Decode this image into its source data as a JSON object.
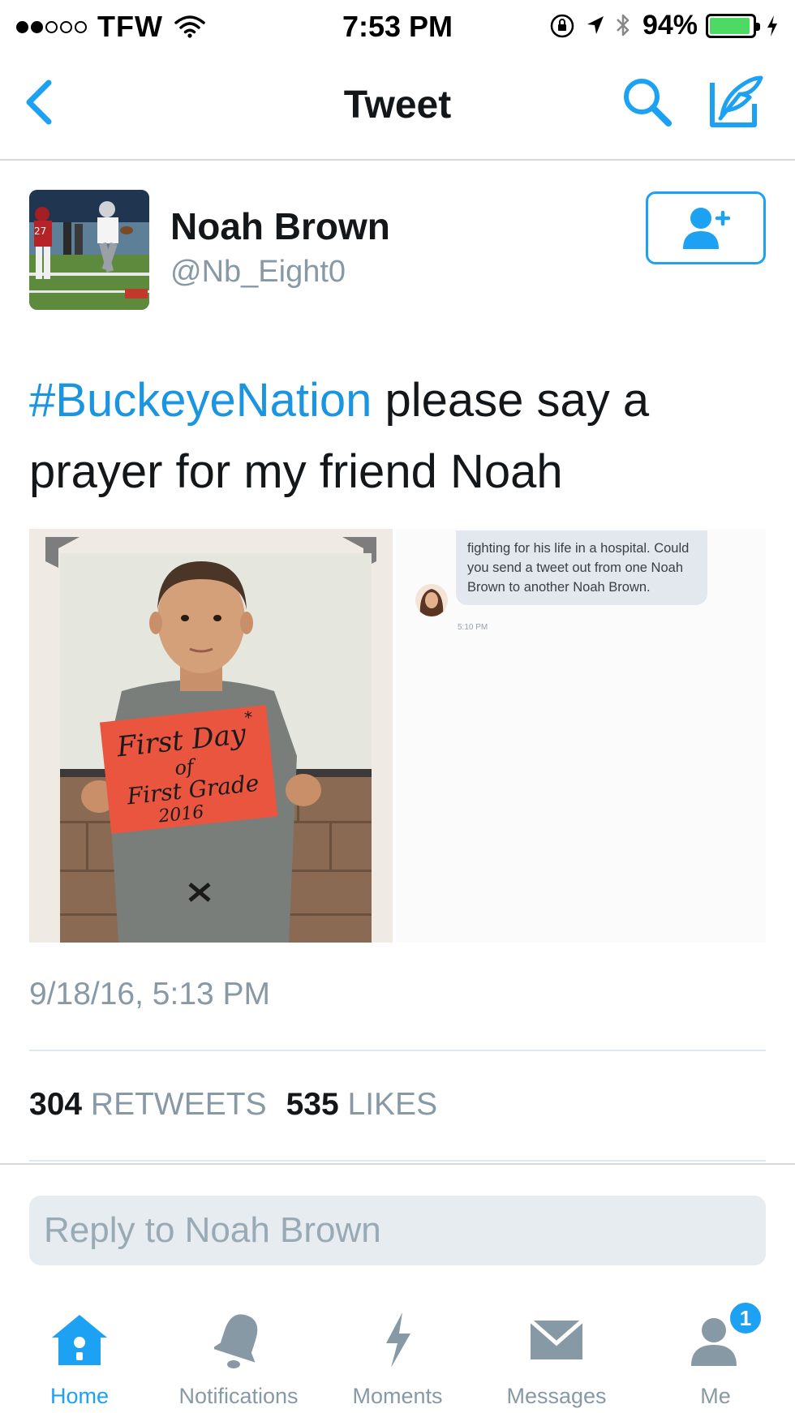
{
  "status_bar": {
    "carrier": "TFW",
    "time": "7:53 PM",
    "battery_percent": "94%",
    "battery_level": 0.94,
    "signal_bars_filled": 2,
    "signal_bars_total": 5
  },
  "nav": {
    "title": "Tweet",
    "back_icon": "chevron-left-icon",
    "search_icon": "search-icon",
    "compose_icon": "compose-tweet-icon"
  },
  "tweet": {
    "author_name": "Noah Brown",
    "author_handle": "@Nb_Eight0",
    "hashtag": "#BuckeyeNation",
    "text_rest": " please say a prayer for my friend Noah",
    "timestamp": "9/18/16, 5:13 PM",
    "retweets_count": "304",
    "retweets_label": "RETWEETS",
    "likes_count": "535",
    "likes_label": "LIKES"
  },
  "media": {
    "sign_line1": "First Day",
    "sign_line2": "of",
    "sign_line3": "First Grade",
    "sign_line4": "2016",
    "message_text": "fighting for his life in a hospital. Could you send a tweet out from one Noah Brown to another Noah Brown.",
    "message_time": "5:10 PM"
  },
  "reply": {
    "placeholder": "Reply to Noah Brown"
  },
  "tabs": [
    {
      "label": "Home",
      "icon": "home-icon",
      "active": true
    },
    {
      "label": "Notifications",
      "icon": "bell-icon",
      "active": false
    },
    {
      "label": "Moments",
      "icon": "lightning-icon",
      "active": false
    },
    {
      "label": "Messages",
      "icon": "envelope-icon",
      "active": false
    },
    {
      "label": "Me",
      "icon": "profile-icon",
      "active": false,
      "badge": "1"
    }
  ],
  "colors": {
    "accent": "#1da1f2",
    "hashtag": "#1b95e0",
    "secondary_text": "#8899a6",
    "battery": "#4cd964"
  }
}
